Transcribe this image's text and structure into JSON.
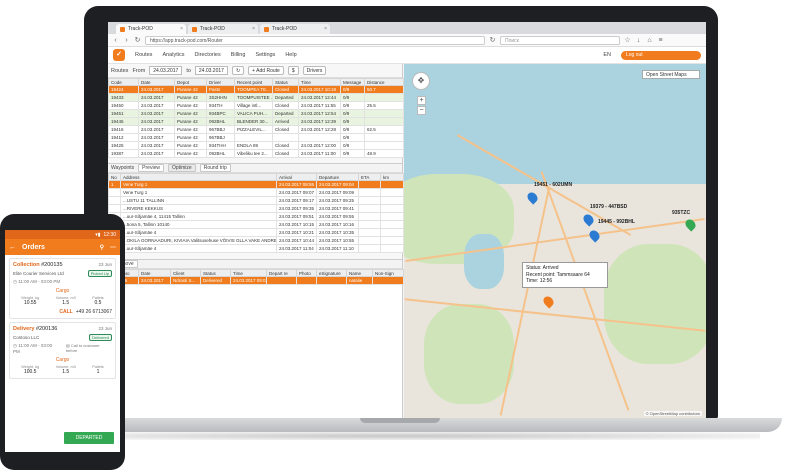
{
  "browser": {
    "tabs": [
      {
        "label": "Track-POD"
      },
      {
        "label": "Track-POD"
      },
      {
        "label": "Track-POD"
      }
    ],
    "url": "https://app.track-pod.com/Router",
    "search_placeholder": "Поиск"
  },
  "app": {
    "menu": [
      "Routes",
      "Analytics",
      "Directories",
      "Billing",
      "Settings",
      "Help"
    ],
    "lang": "EN",
    "logout": "Log out"
  },
  "routes_bar": {
    "label": "Routes",
    "from_label": "From",
    "from_value": "24.03.2017",
    "to_label": "to",
    "to_value": "24.03.2017",
    "add_route": "+ Add Route",
    "drivers": "Drivers"
  },
  "routes_table": {
    "headers": [
      "Code",
      "Date",
      "Depot",
      "Driver",
      "Recent point",
      "Status",
      "Time",
      "Message",
      "Distance"
    ],
    "rows": [
      {
        "cells": [
          "19424",
          "24.03.2017",
          "Purane 42",
          "Pasts",
          "TOOMPEA TE...",
          "Closed",
          "24.03.2017 10:19",
          "0/9",
          "50.7"
        ],
        "state": "sel"
      },
      {
        "cells": [
          "19433",
          "24.03.2017",
          "Purane 42",
          "3S2HHN",
          "TOOMPUISTEE ...",
          "Departed",
          "24.03.2017 12:44",
          "0/9",
          ""
        ],
        "state": "green"
      },
      {
        "cells": [
          "19450",
          "24.03.2017",
          "Purane 42",
          "934TH",
          "Village intl...",
          "Closed",
          "24.03.2017 11:55",
          "0/9",
          "25.5"
        ],
        "state": "white"
      },
      {
        "cells": [
          "19451",
          "24.03.2017",
          "Purane 42",
          "934BPC",
          "VALICA PUH...",
          "Departed",
          "24.03.2017 12:54",
          "0/9",
          ""
        ],
        "state": "green"
      },
      {
        "cells": [
          "19445",
          "24.03.2017",
          "Purane 42",
          "092BHL",
          "BLENDER 30...",
          "Arrived",
          "24.03.2017 12:39",
          "0/9",
          ""
        ],
        "state": "green"
      },
      {
        "cells": [
          "19416",
          "24.03.2017",
          "Purane 42",
          "967BBJ",
          "PIZZALEVIL...",
          "Closed",
          "24.03.2017 12:28",
          "0/9",
          "62.5"
        ],
        "state": "white"
      },
      {
        "cells": [
          "19412",
          "24.03.2017",
          "Purane 42",
          "967BBJ",
          "",
          "",
          "",
          "0/9",
          ""
        ],
        "state": "white"
      },
      {
        "cells": [
          "19425",
          "24.03.2017",
          "Purane 42",
          "934THH",
          "ENDLA 89",
          "Closed",
          "24.03.2017 12:00",
          "0/9",
          ""
        ],
        "state": "white"
      },
      {
        "cells": [
          "19387",
          "24.03.2017",
          "Purane 42",
          "092BHL",
          "Vibeliku tee 2...",
          "Closed",
          "24.03.2017 11:00",
          "0/9",
          "48.9"
        ],
        "state": "white"
      }
    ]
  },
  "waypoints_bar": {
    "label": "Waypoints",
    "preview": "Preview",
    "optimize": "Optimize",
    "round_trip": "Round trip"
  },
  "waypoints_table": {
    "headers": [
      "No",
      "Address",
      "Arrival",
      "Departure",
      "ETA",
      "km"
    ],
    "rows": [
      {
        "cells": [
          "1",
          "Vene Turg 1",
          "24.03.2017 08:55",
          "24.03.2017 09:04",
          "",
          ""
        ],
        "state": "sel"
      },
      {
        "cells": [
          "",
          "Vene Turg 1",
          "24.03.2017 09:07",
          "24.03.2017 09:09",
          "",
          ""
        ],
        "state": "white"
      },
      {
        "cells": [
          "",
          "...USTU 11 TALLINN",
          "24.03.2017 09:17",
          "24.03.2017 09:25",
          "",
          ""
        ],
        "state": "white"
      },
      {
        "cells": [
          "",
          "...RIVERE KEKKUS",
          "24.03.2017 09:35",
          "24.03.2017 09:41",
          "",
          ""
        ],
        "state": "white"
      },
      {
        "cells": [
          "",
          "...uur-Sõjamäe 4, 11415 Tallinn",
          "24.03.2017 09:51",
          "24.03.2017 09:55",
          "",
          ""
        ],
        "state": "white"
      },
      {
        "cells": [
          "",
          "...5ona 5, Tallinn 10140",
          "24.03.2017 10:15",
          "24.03.2017 10:16",
          "",
          ""
        ],
        "state": "white"
      },
      {
        "cells": [
          "",
          "...uur-Sõjamäe 4",
          "24.03.2017 10:21",
          "24.03.2017 10:35",
          "",
          ""
        ],
        "state": "white"
      },
      {
        "cells": [
          "",
          "...OKILA GORNAADURI, KIVIAIA Valitsusehuse VÕIVIS GLLA VAKE ANDRESS TI",
          "24.03.2017 10:44",
          "24.03.2017 10:55",
          "",
          ""
        ],
        "state": "white"
      },
      {
        "cells": [
          "",
          "...uur-Sõjamäe 4",
          "24.03.2017 11:04",
          "24.03.2017 11:10",
          "",
          ""
        ],
        "state": "white"
      }
    ]
  },
  "orders_bar": {
    "remove": "Remove"
  },
  "orders_table": {
    "headers": [
      "Order No",
      "Date",
      "Client",
      "Status",
      "Time",
      "Depart re",
      "Photo",
      "eSignature",
      "Name",
      "Non-Sign"
    ],
    "rows": [
      {
        "cells": [
          "...17826",
          "24.03.2017",
          "Ndrasti S...",
          "Delivered",
          "24.03.2017 09:03",
          "",
          "",
          "",
          "natalie",
          ""
        ],
        "state": "sel"
      }
    ]
  },
  "map": {
    "layer": "Open Street Maps",
    "markers": [
      {
        "label": "19451 - 602UMN"
      },
      {
        "label": "19379 - 447BSD"
      },
      {
        "label": "19445 - 992BHL"
      },
      {
        "label": "935TZC"
      }
    ],
    "tooltip": {
      "status": "Status: Arrived",
      "recent": "Recent point: Tammsaare 64",
      "time": "Time: 12:56"
    },
    "attribution": "© OpenStreetMap contributors"
  },
  "phone": {
    "status_time": "12:30",
    "title": "Orders",
    "orders": [
      {
        "type": "Collection",
        "number": "#200135",
        "date": "23 Jun",
        "client": "Elite Courier Services Ltd",
        "badge": "Picked Up",
        "time": "11:00 AM - 03:00 PM",
        "cargo_label": "Cargo",
        "cargo": [
          {
            "label": "Weight, kg",
            "value": "10.55"
          },
          {
            "label": "Volume, m3",
            "value": "1.5"
          },
          {
            "label": "Pallets",
            "value": "0.5"
          }
        ],
        "call_label": "CALL",
        "phone": "+49 26 6713067"
      },
      {
        "type": "Delivery",
        "number": "#200136",
        "date": "23 Jun",
        "client": "Contoso LLC",
        "badge": "Delivered",
        "time": "11:00 AM - 03:00 PM",
        "note": "Call to customer before",
        "cargo_label": "Cargo",
        "cargo": [
          {
            "label": "Weight, kg",
            "value": "100.5"
          },
          {
            "label": "Volume, m3",
            "value": "1.5"
          },
          {
            "label": "Pallets",
            "value": "1"
          }
        ]
      }
    ],
    "departed": "DEPARTED"
  }
}
